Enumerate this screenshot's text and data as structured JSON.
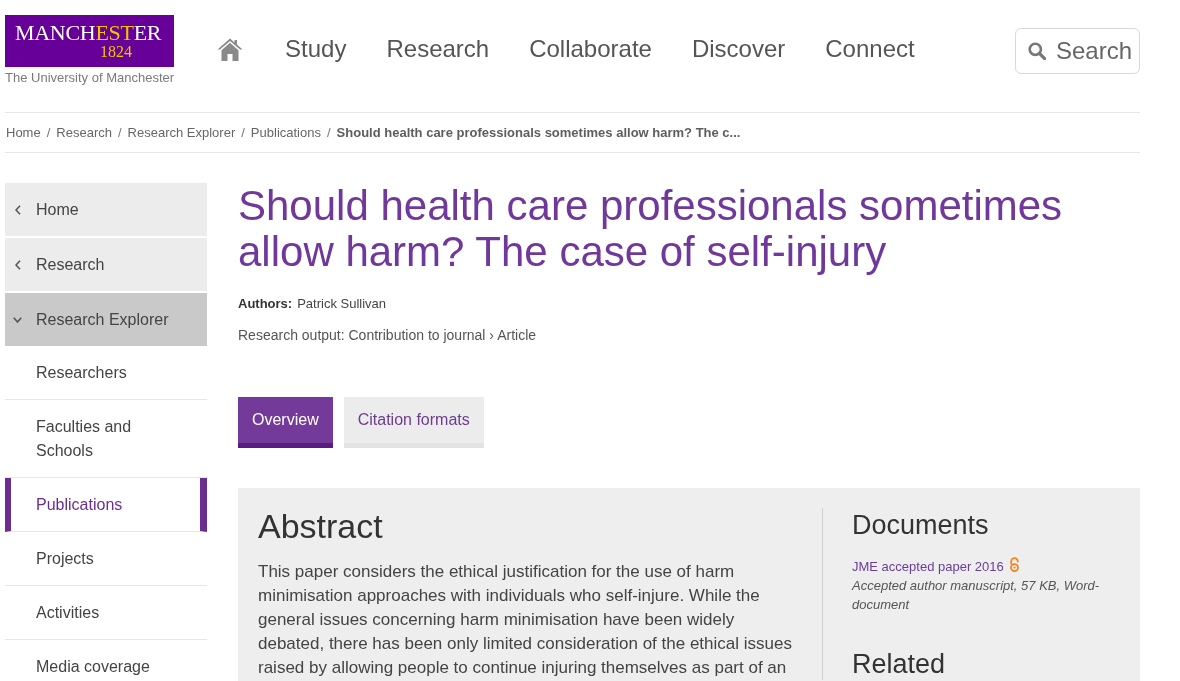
{
  "logo": {
    "wordmark": [
      {
        "text": "MANCH",
        "highlight": false
      },
      {
        "text": "EST",
        "highlight": true
      },
      {
        "text": "ER",
        "highlight": false
      }
    ],
    "year": "1824",
    "tagline": "The University of Manchester"
  },
  "nav": {
    "items": [
      "Study",
      "Research",
      "Collaborate",
      "Discover",
      "Connect"
    ]
  },
  "search_button": {
    "label": "Search"
  },
  "breadcrumb": {
    "separator": "/",
    "items": [
      {
        "label": "Home",
        "current": false
      },
      {
        "label": "Research",
        "current": false
      },
      {
        "label": "Research Explorer",
        "current": false
      },
      {
        "label": "Publications",
        "current": false
      },
      {
        "label": "Should health care professionals sometimes allow harm? The c...",
        "current": true
      }
    ]
  },
  "sidebar": {
    "items": [
      {
        "label": "Home",
        "kind": "ancestor",
        "selected": false
      },
      {
        "label": "Research",
        "kind": "ancestor",
        "selected": false
      },
      {
        "label": "Research Explorer",
        "kind": "section",
        "selected": false,
        "expanded": true,
        "children": [
          {
            "label": "Researchers",
            "selected": false
          },
          {
            "label": "Faculties and Schools",
            "selected": false
          },
          {
            "label": "Publications",
            "selected": true
          },
          {
            "label": "Projects",
            "selected": false
          },
          {
            "label": "Activities",
            "selected": false
          },
          {
            "label": "Media coverage",
            "selected": false
          }
        ]
      }
    ]
  },
  "publication": {
    "title": "Should health care professionals sometimes allow harm? The case of self-injury",
    "authors_label": "Authors:",
    "authors": "Patrick Sullivan",
    "output_type": "Research output: Contribution to journal › Article"
  },
  "tabs": [
    {
      "label": "Overview",
      "selected": true
    },
    {
      "label": "Citation formats",
      "selected": false
    }
  ],
  "abstract": {
    "heading": "Abstract",
    "text": "This paper considers the ethical justification for the use of harm minimisation approaches with individuals who self-injure. While the general issues concerning harm minimisation have been widely debated, there has been only limited consideration of the ethical issues raised by allowing people to continue injuring themselves as part of an"
  },
  "documents": {
    "heading": "Documents",
    "items": [
      {
        "title": "JME accepted paper 2016",
        "open_access": true,
        "description": "Accepted author manuscript, 57 KB, Word-document"
      }
    ]
  },
  "related": {
    "heading": "Related"
  }
}
